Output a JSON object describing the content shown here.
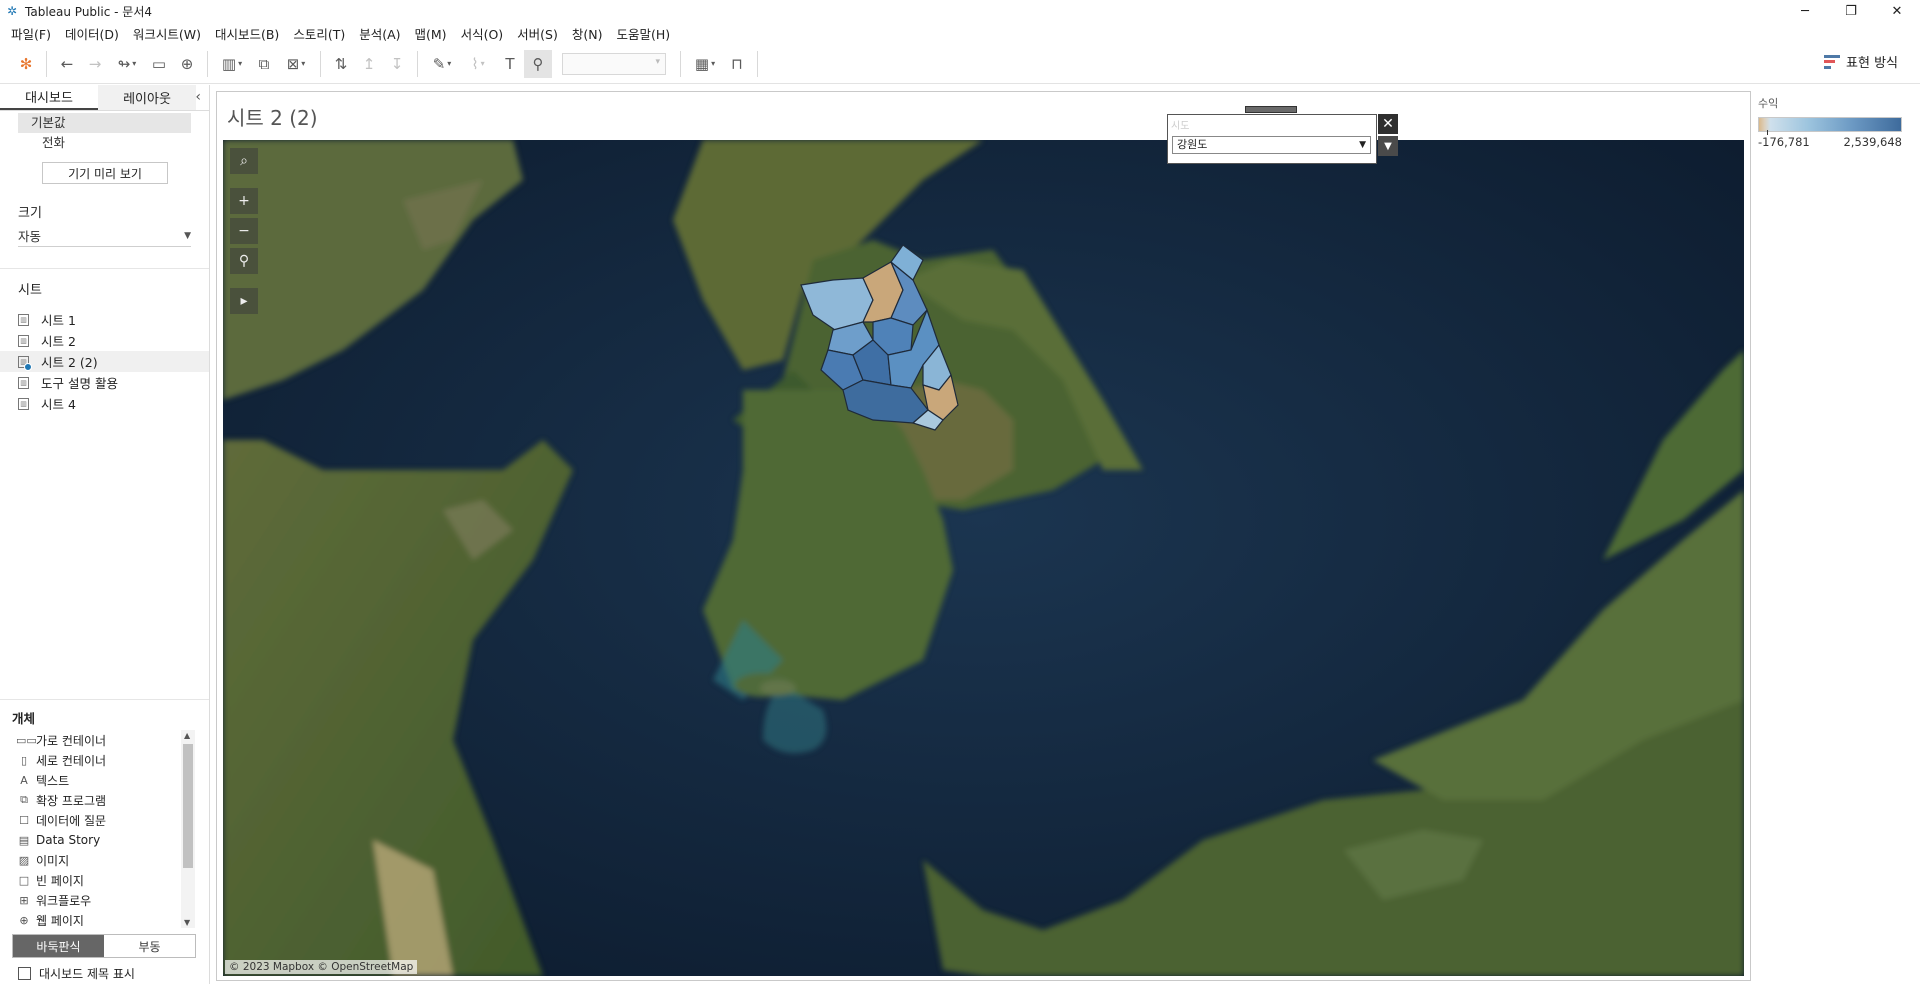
{
  "window": {
    "title": "Tableau Public - 문서4",
    "minimize": "─",
    "restore": "❐",
    "close": "✕"
  },
  "menu": [
    "파일(F)",
    "데이터(D)",
    "워크시트(W)",
    "대시보드(B)",
    "스토리(T)",
    "분석(A)",
    "맵(M)",
    "서식(O)",
    "서버(S)",
    "창(N)",
    "도움말(H)"
  ],
  "toolbar": {
    "show_me_label": "표현 방식"
  },
  "left_pane": {
    "tabs": [
      "대시보드",
      "레이아웃"
    ],
    "devices": [
      "기본값",
      "전화"
    ],
    "device_preview_button": "기기 미리 보기",
    "size_title": "크기",
    "size_value": "자동",
    "sheets_title": "시트",
    "sheets": [
      "시트 1",
      "시트 2",
      "시트 2 (2)",
      "도구 설명 활용",
      "시트 4"
    ],
    "selected_sheet": "시트 2 (2)",
    "objects_title": "개체",
    "objects": [
      {
        "label": "가로 컨테이너",
        "icon": "horizontal-container-icon",
        "glyph": "▭▭"
      },
      {
        "label": "세로 컨테이너",
        "icon": "vertical-container-icon",
        "glyph": "▯"
      },
      {
        "label": "텍스트",
        "icon": "text-icon",
        "glyph": "A"
      },
      {
        "label": "확장 프로그램",
        "icon": "extension-icon",
        "glyph": "⧉"
      },
      {
        "label": "데이터에 질문",
        "icon": "ask-data-icon",
        "glyph": "☐"
      },
      {
        "label": "Data Story",
        "icon": "data-story-icon",
        "glyph": "▤"
      },
      {
        "label": "이미지",
        "icon": "image-icon",
        "glyph": "▨"
      },
      {
        "label": "빈 페이지",
        "icon": "blank-icon",
        "glyph": "□"
      },
      {
        "label": "워크플로우",
        "icon": "workflow-icon",
        "glyph": "⊞"
      },
      {
        "label": "웹 페이지",
        "icon": "web-page-icon",
        "glyph": "⊕"
      }
    ],
    "layout_modes": [
      "바둑판식",
      "부동"
    ],
    "active_layout_mode": "바둑판식",
    "show_dashboard_title": "대시보드 제목 표시"
  },
  "dashboard": {
    "title": "시트 2 (2)",
    "attribution": "© 2023 Mapbox © OpenStreetMap",
    "filter": {
      "label": "시도",
      "value": "강원도"
    }
  },
  "legend": {
    "title": "수익",
    "min": "-176,781",
    "max": "2,539,648",
    "colors": {
      "negative": "#d9b98c",
      "low": "#cfe0ec",
      "high": "#3e6b9c"
    }
  }
}
